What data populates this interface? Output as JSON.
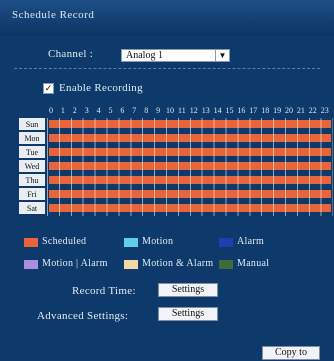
{
  "window": {
    "title": "Schedule Record"
  },
  "channel": {
    "label": "Channel :",
    "value": "Analog 1"
  },
  "enable_recording": {
    "label": "Enable Recording",
    "checked": true
  },
  "schedule": {
    "hours": [
      "0",
      "1",
      "2",
      "3",
      "4",
      "5",
      "6",
      "7",
      "8",
      "9",
      "10",
      "11",
      "12",
      "13",
      "14",
      "15",
      "16",
      "17",
      "18",
      "19",
      "20",
      "21",
      "22",
      "23"
    ],
    "days": [
      "Sun",
      "Mon",
      "Tue",
      "Wed",
      "Thu",
      "Fri",
      "Sat"
    ],
    "fill_color": "#e8643a"
  },
  "legend": [
    {
      "label": "Scheduled",
      "color": "#e8643a"
    },
    {
      "label": "Motion",
      "color": "#5fd0e8"
    },
    {
      "label": "Alarm",
      "color": "#1f3fb0"
    },
    {
      "label": "Motion | Alarm",
      "color": "#a98fe0"
    },
    {
      "label": "Motion & Alarm",
      "color": "#f0d9a8"
    },
    {
      "label": "Manual",
      "color": "#3f6b3a"
    }
  ],
  "record_time": {
    "label": "Record Time:",
    "button": "Settings"
  },
  "advanced": {
    "label": "Advanced Settings:",
    "button": "Settings"
  },
  "copy_to": {
    "button": "Copy to"
  }
}
